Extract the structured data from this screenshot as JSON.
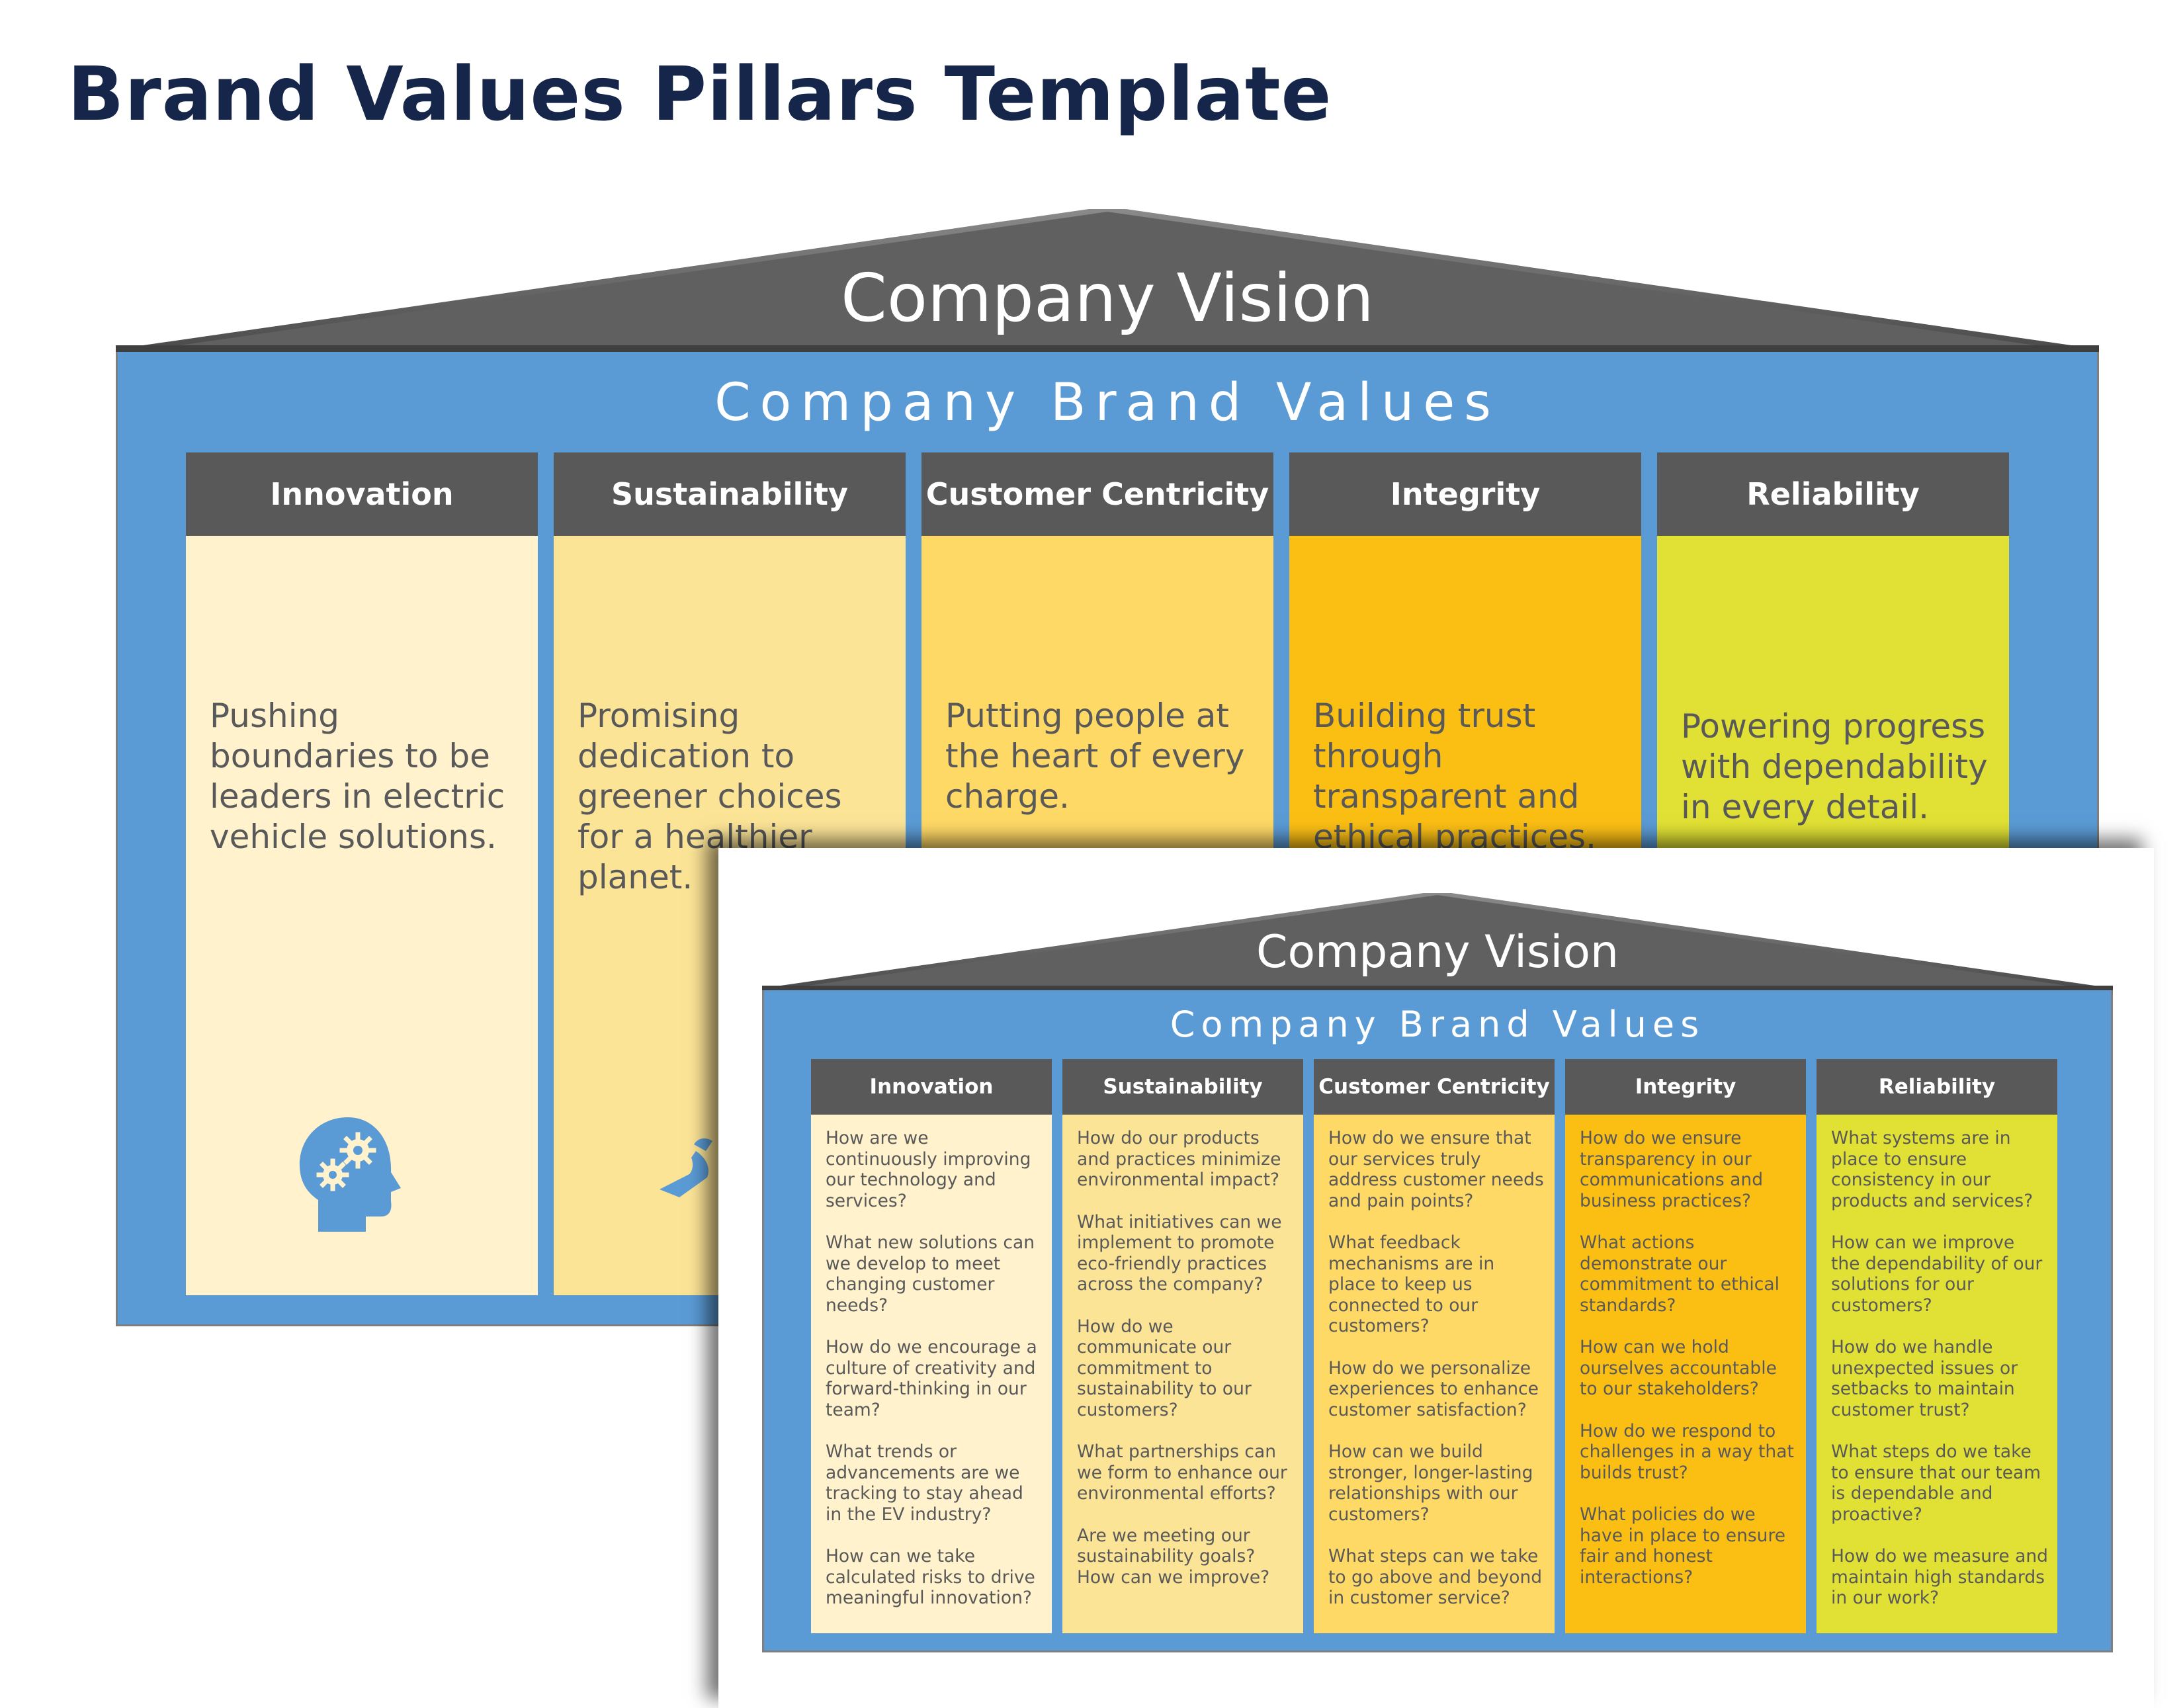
{
  "page": {
    "title": "Brand Values Pillars Template"
  },
  "colors": {
    "title": "#16254a",
    "roof": "#5f605f",
    "house_body": "#5b9bd5",
    "pillar_header": "#595959",
    "text": "#595959",
    "icon": "#5b9bd5",
    "pillar_fills": [
      "#fff2cc",
      "#fce497",
      "#ffd966",
      "#fbbf14",
      "#e1e135"
    ]
  },
  "back_slide": {
    "vision_label": "Company Vision",
    "brand_values_label": "Company Brand Values",
    "pillars": [
      {
        "name": "Innovation",
        "description": "Pushing boundaries to be leaders in electric vehicle solutions.",
        "icon": "head-gears-icon"
      },
      {
        "name": "Sustainability",
        "description": "Promising dedication to greener choices for a healthier planet.",
        "icon": "sustainability-icon"
      },
      {
        "name": "Customer Centricity",
        "description": "Putting people at the heart of every charge."
      },
      {
        "name": "Integrity",
        "description": "Building trust through transparent and ethical practices."
      },
      {
        "name": "Reliability",
        "description": "Powering progress with dependability in every detail."
      }
    ]
  },
  "front_slide": {
    "vision_label": "Company Vision",
    "brand_values_label": "Company Brand Values",
    "pillars": [
      {
        "name": "Innovation",
        "questions": [
          "How are we continuously improving our technology and services?",
          "What new solutions can we develop to meet changing customer needs?",
          "How do we encourage a culture of creativity and forward-thinking in our team?",
          "What trends or advancements are we tracking to stay ahead in the EV industry?",
          "How can we take calculated risks to drive meaningful innovation?"
        ]
      },
      {
        "name": "Sustainability",
        "questions": [
          "How do our products and practices minimize environmental impact?",
          "What initiatives can we implement to promote eco-friendly practices across the company?",
          "How do we communicate our commitment to sustainability to our customers?",
          "What partnerships can we form to enhance our environmental efforts?",
          "Are we meeting our sustainability goals? How can we improve?"
        ]
      },
      {
        "name": "Customer Centricity",
        "questions": [
          "How do we ensure that our services truly address customer needs and pain points?",
          "What feedback mechanisms are in place to keep us connected to our customers?",
          "How do we personalize experiences to enhance customer satisfaction?",
          "How can we build stronger, longer-lasting relationships with our customers?",
          "What steps can we take to go above and beyond in customer service?"
        ]
      },
      {
        "name": "Integrity",
        "questions": [
          "How do we ensure transparency in our communications and business practices?",
          "What actions demonstrate our commitment to ethical standards?",
          "How can we hold ourselves accountable to our stakeholders?",
          "How do we respond to challenges in a way that builds trust?",
          "What policies do we have in place to ensure fair and honest interactions?"
        ]
      },
      {
        "name": "Reliability",
        "questions": [
          "What systems are in place to ensure consistency in our products and services?",
          "How can we improve the dependability of our solutions for our customers?",
          "How do we handle unexpected issues or setbacks to maintain customer trust?",
          "What steps do we take to ensure that our team is dependable and proactive?",
          "How do we measure and maintain high standards in our work?"
        ]
      }
    ]
  }
}
